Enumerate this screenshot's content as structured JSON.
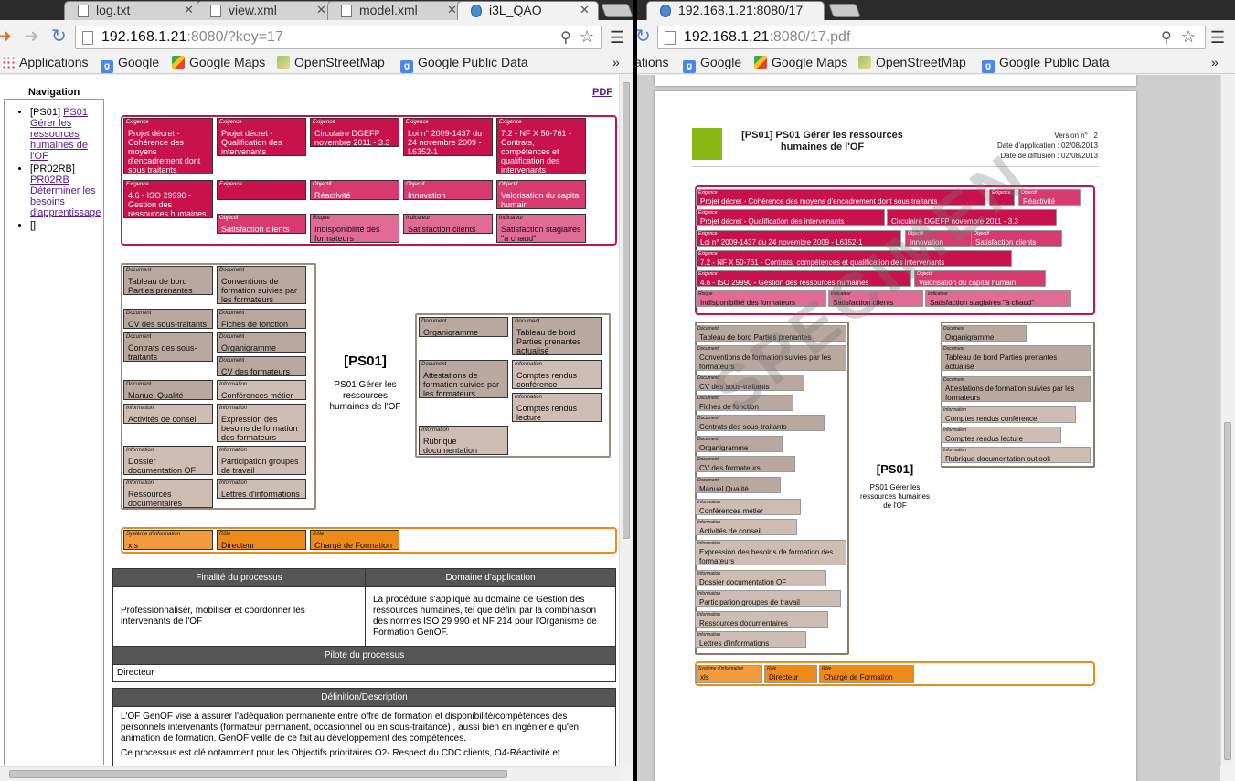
{
  "left_window": {
    "tabs": [
      {
        "label": "log.txt"
      },
      {
        "label": "view.xml"
      },
      {
        "label": "model.xml"
      },
      {
        "label": "i3L_QAO"
      }
    ],
    "url": {
      "host": "192.168.1.21",
      "path": ":8080/?key=17"
    },
    "bookmarks": [
      {
        "label": "Applications"
      },
      {
        "label": "Google"
      },
      {
        "label": "Google Maps"
      },
      {
        "label": "OpenStreetMap"
      },
      {
        "label": "Google Public Data"
      }
    ],
    "navigation_title": "Navigation",
    "nav_items": [
      {
        "prefix": "[PS01]",
        "link": "PS01 Gérer les ressources humaines de l'OF"
      },
      {
        "prefix": "[PR02RB]",
        "link": "PR02RB Déterminer les besoins d'apprentissage"
      },
      {
        "prefix": "[]",
        "link": ""
      }
    ],
    "pdf_link": "PDF",
    "cards": [
      {
        "cat": "Exigence",
        "text": "Projet décret - Cohérence des moyens d'encadrement dont sous traitants"
      },
      {
        "cat": "Exigence",
        "text": "Projet décret - Qualification des intervenants"
      },
      {
        "cat": "Exigence",
        "text": "Circulaire DGEFP novembre 2011 - 3.3"
      },
      {
        "cat": "Exigence",
        "text": "Loi n° 2009-1437 du 24 novembre 2009 - L6352-1"
      },
      {
        "cat": "Exigence",
        "text": "7.2 - NF X 50-761 - Contrats, compétences et qualification des intervenants"
      },
      {
        "cat": "Exigence",
        "text": "4.6 - ISO 29990 - Gestion des ressources humaines"
      },
      {
        "cat": "Exigence",
        "text": ""
      },
      {
        "cat": "Objectif",
        "text": "Réactivité"
      },
      {
        "cat": "Objectif",
        "text": "Innovation"
      },
      {
        "cat": "Objectif",
        "text": "Valorisation du capital humain"
      },
      {
        "cat": "Objectif",
        "text": "Satisfaction clients"
      },
      {
        "cat": "Risque",
        "text": "Indisponibilité des formateurs"
      },
      {
        "cat": "Indicateur",
        "text": "Satisfaction clients"
      },
      {
        "cat": "Indicateur",
        "text": "Satisfaction stagiaires \"à chaud\""
      },
      {
        "cat": "Document",
        "text": "Tableau de bord Parties prenantes"
      },
      {
        "cat": "Document",
        "text": "Conventions de formation suivies par les formateurs"
      },
      {
        "cat": "Document",
        "text": "CV des sous-traitants"
      },
      {
        "cat": "Document",
        "text": "Fiches de fonction"
      },
      {
        "cat": "Document",
        "text": "Contrats des sous-traitants"
      },
      {
        "cat": "Document",
        "text": "Organigramme"
      },
      {
        "cat": "Document",
        "text": "CV des formateurs"
      },
      {
        "cat": "Document",
        "text": "Manuel Qualité"
      },
      {
        "cat": "Information",
        "text": "Conférences métier"
      },
      {
        "cat": "Information",
        "text": "Activités de conseil"
      },
      {
        "cat": "Information",
        "text": "Expression des besoins de formation des formateurs"
      },
      {
        "cat": "Information",
        "text": "Dossier documentation OF"
      },
      {
        "cat": "Information",
        "text": "Participation groupes de travail"
      },
      {
        "cat": "Information",
        "text": "Ressources documentaires"
      },
      {
        "cat": "Information",
        "text": "Lettres d'informations"
      },
      {
        "cat": "Document",
        "text": "Organigramme"
      },
      {
        "cat": "Document",
        "text": "Tableau de bord Parties prenantes actualisé"
      },
      {
        "cat": "Document",
        "text": "Attestations de formation suivies par les formateurs"
      },
      {
        "cat": "Information",
        "text": "Comptes rendus conférence"
      },
      {
        "cat": "Information",
        "text": "Comptes rendus lecture"
      },
      {
        "cat": "Information",
        "text": "Rubrique documentation outlook"
      },
      {
        "cat": "Système d'information",
        "text": "xls"
      },
      {
        "cat": "Rôle",
        "text": "Directeur"
      },
      {
        "cat": "Rôle",
        "text": "Chargé de Formation"
      }
    ],
    "process": {
      "code": "[PS01]",
      "name": "PS01 Gérer les ressources humaines de l'OF"
    },
    "table": {
      "finalite_header": "Finalité du processus",
      "domaine_header": "Domaine d'application",
      "finalite_text": "Professionnaliser, mobiliser et coordonner les intervenants de l'OF",
      "domaine_text": "La procédure s'applique au domaine de Gestion des ressources humaines, tel que défini par la combinaison des normes ISO 29 990 et NF 214 pour l'Organisme de Formation GenOF.",
      "pilote_header": "Pilote du processus",
      "pilote_text": "Directeur",
      "definition_header": "Définition/Description",
      "definition_p1": "L'OF GenOF vise à assurer l'adéquation permanente entre offre de formation et disponibilité/compétences des personnels intervenants (formateur permanent, occasionnel ou en sous-traitance) , aussi bien en ingénierie qu'en animation de formation. GenOF veille de ce fait au développement des compétences.",
      "definition_p2": "Ce processus est clé notamment pour les Objectifs prioritaires O2- Respect du CDC clients, O4-Réactivité et"
    }
  },
  "right_window": {
    "tab": {
      "label": "192.168.1.21:8080/17"
    },
    "url": {
      "host": "192.168.1.21",
      "path": ":8080/17.pdf"
    },
    "bookmarks": [
      {
        "label": "Applications"
      },
      {
        "label": "Google"
      },
      {
        "label": "Google Maps"
      },
      {
        "label": "OpenStreetMap"
      },
      {
        "label": "Google Public Data"
      }
    ],
    "doc_title": "[PS01] PS01 Gérer les ressources humaines de l'OF",
    "version": "Version n° : 2",
    "date_application": "Date d'application : 02/08/2013",
    "date_diffusion": "Date de diffusion : 02/08/2013",
    "watermark": "SPECIMEN",
    "cards": [
      {
        "cat": "Exigence",
        "text": "Projet décret - Cohérence des moyens d'encadrement dont sous traitants"
      },
      {
        "cat": "Exigence",
        "text": ""
      },
      {
        "cat": "Objectif",
        "text": "Réactivité"
      },
      {
        "cat": "Exigence",
        "text": "Projet décret - Qualification des intervenants"
      },
      {
        "cat": "",
        "text": "Circulaire DGEFP novembre 2011 - 3.3"
      },
      {
        "cat": "Exigence",
        "text": "Loi n° 2009-1437 du 24 novembre 2009 - L6352-1"
      },
      {
        "cat": "Objectif",
        "text": "Innovation"
      },
      {
        "cat": "Objectif",
        "text": "Satisfaction clients"
      },
      {
        "cat": "Exigence",
        "text": "7.2 - NF X 50-761 - Contrats, compétences et qualification des intervenants"
      },
      {
        "cat": "Exigence",
        "text": "4.6 - ISO 29990 - Gestion des ressources humaines"
      },
      {
        "cat": "Objectif",
        "text": "Valorisation du capital humain"
      },
      {
        "cat": "Risque",
        "text": "Indisponibilité des formateurs"
      },
      {
        "cat": "Indicateur",
        "text": "Satisfaction clients"
      },
      {
        "cat": "Indicateur",
        "text": "Satisfaction stagiaires \"à chaud\""
      },
      {
        "cat": "Document",
        "text": "Tableau de bord Parties prenantes"
      },
      {
        "cat": "Document",
        "text": "Conventions de formation suivies par les formateurs"
      },
      {
        "cat": "Document",
        "text": "CV des sous-traitants"
      },
      {
        "cat": "Document",
        "text": "Fiches de fonction"
      },
      {
        "cat": "Document",
        "text": "Contrats des sous-traitants"
      },
      {
        "cat": "Document",
        "text": "Organigramme"
      },
      {
        "cat": "Document",
        "text": "CV des formateurs"
      },
      {
        "cat": "Document",
        "text": "Manuel Qualité"
      },
      {
        "cat": "Information",
        "text": "Conférences métier"
      },
      {
        "cat": "Information",
        "text": "Activités de conseil"
      },
      {
        "cat": "Information",
        "text": "Expression des besoins de formation des formateurs"
      },
      {
        "cat": "Information",
        "text": "Dossier documentation OF"
      },
      {
        "cat": "Information",
        "text": "Participation groupes de travail"
      },
      {
        "cat": "Information",
        "text": "Ressources documentaires"
      },
      {
        "cat": "Information",
        "text": "Lettres d'informations"
      },
      {
        "cat": "Document",
        "text": "Organigramme"
      },
      {
        "cat": "Document",
        "text": "Tableau de bord Parties prenantes actualisé"
      },
      {
        "cat": "Document",
        "text": "Attestations de formation suivies par les formateurs"
      },
      {
        "cat": "Information",
        "text": "Comptes rendus conférence"
      },
      {
        "cat": "Information",
        "text": "Comptes rendus lecture"
      },
      {
        "cat": "Information",
        "text": "Rubrique documentation outlook"
      },
      {
        "cat": "Système d'information",
        "text": "xls"
      },
      {
        "cat": "Rôle",
        "text": "Directeur"
      },
      {
        "cat": "Rôle",
        "text": "Chargé de Formation"
      }
    ],
    "process": {
      "code": "[PS01]",
      "name": "PS01 Gérer les ressources humaines de l'OF"
    }
  },
  "colors": {
    "exigence": "#c8124c",
    "objectif": "#d63a6e",
    "indicateur": "#e06b95",
    "document": "#b8a89d",
    "information": "#cdbdb2",
    "systeme": "#f19a3e",
    "role": "#ee8a1a",
    "logo_green": "#8cb814"
  },
  "icons": [
    "back-arrow-icon",
    "forward-arrow-icon",
    "reload-icon",
    "page-icon",
    "zoom-icon",
    "star-icon",
    "menu-icon",
    "apps-grid-icon",
    "google-icon",
    "maps-icon",
    "osm-icon",
    "chevron-more-icon",
    "globe-icon",
    "close-icon"
  ]
}
